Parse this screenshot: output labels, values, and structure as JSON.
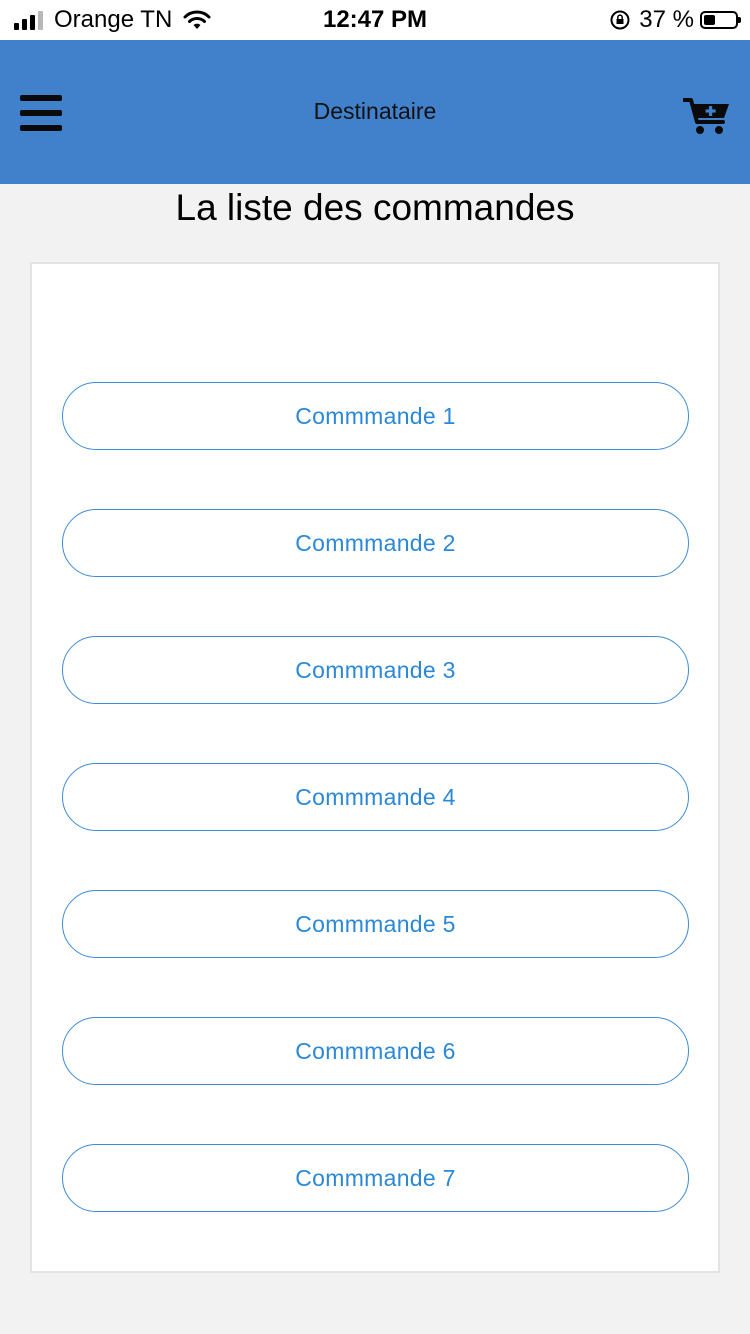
{
  "status_bar": {
    "carrier": "Orange TN",
    "time": "12:47 PM",
    "battery_percent": "37 %",
    "battery_level": 0.37,
    "signal_bars_active": 3,
    "icons": [
      "signal-icon",
      "wifi-icon",
      "rotation-lock-icon",
      "battery-icon"
    ]
  },
  "header": {
    "title": "Destinataire",
    "background_color": "#4181cc",
    "menu_icon": "hamburger-menu-icon",
    "cart_icon": "cart-plus-icon"
  },
  "page": {
    "title": "La liste des commandes"
  },
  "orders": [
    {
      "label": "Commmande 1"
    },
    {
      "label": "Commmande 2"
    },
    {
      "label": "Commmande 3"
    },
    {
      "label": "Commmande 4"
    },
    {
      "label": "Commmande 5"
    },
    {
      "label": "Commmande 6"
    },
    {
      "label": "Commmande 7"
    }
  ],
  "colors": {
    "accent": "#2a88d6",
    "page_background": "#f2f2f2",
    "card_background": "#ffffff"
  }
}
